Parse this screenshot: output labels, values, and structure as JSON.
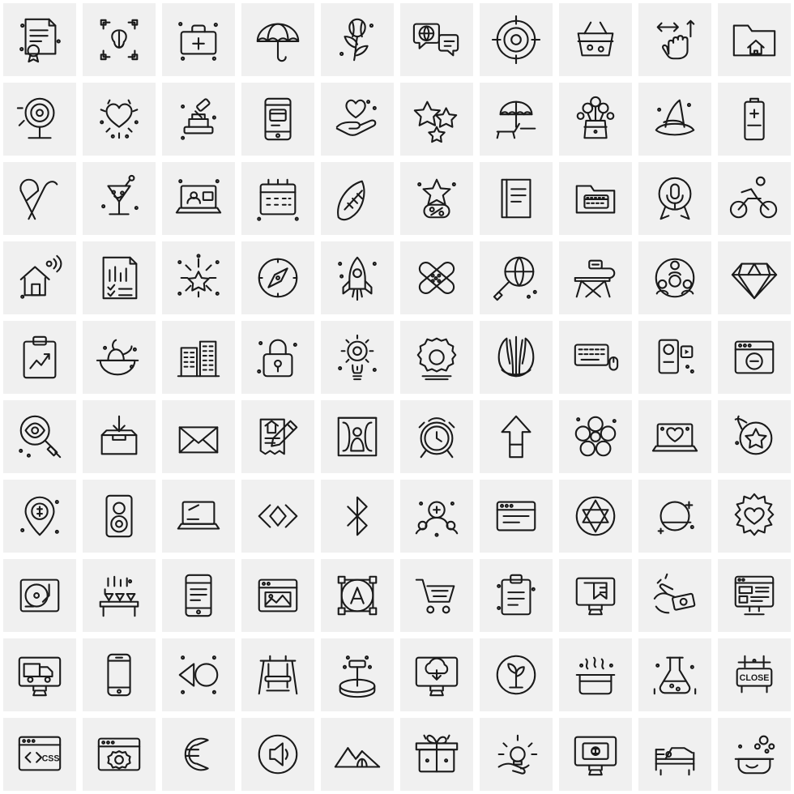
{
  "page": {
    "title": "100 Line Icon Set",
    "layout": {
      "columns": 10,
      "rows": 10,
      "cell_size_px": 98
    },
    "colors": {
      "page_background": "#ffffff",
      "cell_background": "#f0f0f0",
      "icon_stroke": "#1a1a1a"
    }
  },
  "icons": [
    {
      "row": 1,
      "col": 1,
      "name": "certificate-icon",
      "label": "Certificate"
    },
    {
      "row": 1,
      "col": 2,
      "name": "brain-select-icon",
      "label": "Brain Selection"
    },
    {
      "row": 1,
      "col": 3,
      "name": "first-aid-kit-icon",
      "label": "First Aid Kit"
    },
    {
      "row": 1,
      "col": 4,
      "name": "umbrella-icon",
      "label": "Umbrella"
    },
    {
      "row": 1,
      "col": 5,
      "name": "tulip-flower-icon",
      "label": "Tulip"
    },
    {
      "row": 1,
      "col": 6,
      "name": "global-chat-icon",
      "label": "Global Chat"
    },
    {
      "row": 1,
      "col": 7,
      "name": "target-crosshair-icon",
      "label": "Target"
    },
    {
      "row": 1,
      "col": 8,
      "name": "shopping-basket-icon",
      "label": "Shopping Basket"
    },
    {
      "row": 1,
      "col": 9,
      "name": "drag-move-hand-icon",
      "label": "Drag Move"
    },
    {
      "row": 1,
      "col": 10,
      "name": "home-folder-icon",
      "label": "Home Folder"
    },
    {
      "row": 2,
      "col": 1,
      "name": "target-stand-icon",
      "label": "Target Stand"
    },
    {
      "row": 2,
      "col": 2,
      "name": "sparkle-hearts-icon",
      "label": "Sparkling Hearts"
    },
    {
      "row": 2,
      "col": 3,
      "name": "auction-gavel-icon",
      "label": "Auction Gavel"
    },
    {
      "row": 2,
      "col": 4,
      "name": "mobile-payment-icon",
      "label": "Mobile Payment"
    },
    {
      "row": 2,
      "col": 5,
      "name": "hand-heart-icon",
      "label": "Hand with Hearts"
    },
    {
      "row": 2,
      "col": 6,
      "name": "three-stars-icon",
      "label": "Three Stars"
    },
    {
      "row": 2,
      "col": 7,
      "name": "beach-lounger-icon",
      "label": "Beach Lounger"
    },
    {
      "row": 2,
      "col": 8,
      "name": "flower-bouquet-icon",
      "label": "Flower Bouquet"
    },
    {
      "row": 2,
      "col": 9,
      "name": "witch-hat-icon",
      "label": "Witch Hat"
    },
    {
      "row": 2,
      "col": 10,
      "name": "battery-icon",
      "label": "Battery"
    },
    {
      "row": 3,
      "col": 1,
      "name": "awareness-ribbon-icon",
      "label": "Awareness Ribbon"
    },
    {
      "row": 3,
      "col": 2,
      "name": "cocktail-glass-icon",
      "label": "Cocktail"
    },
    {
      "row": 3,
      "col": 3,
      "name": "video-call-laptop-icon",
      "label": "Video Call"
    },
    {
      "row": 3,
      "col": 4,
      "name": "calendar-icon",
      "label": "Calendar"
    },
    {
      "row": 3,
      "col": 5,
      "name": "american-football-icon",
      "label": "American Football"
    },
    {
      "row": 3,
      "col": 6,
      "name": "star-discount-tag-icon",
      "label": "Star Discount"
    },
    {
      "row": 3,
      "col": 7,
      "name": "document-file-icon",
      "label": "Document"
    },
    {
      "row": 3,
      "col": 8,
      "name": "taxi-screen-icon",
      "label": "Taxi Display"
    },
    {
      "row": 3,
      "col": 9,
      "name": "microphone-badge-icon",
      "label": "Microphone Badge"
    },
    {
      "row": 3,
      "col": 10,
      "name": "cyclist-icon",
      "label": "Cyclist"
    },
    {
      "row": 4,
      "col": 1,
      "name": "smart-home-signal-icon",
      "label": "Smart Home Signal"
    },
    {
      "row": 4,
      "col": 2,
      "name": "report-checklist-icon",
      "label": "Report Checklist"
    },
    {
      "row": 4,
      "col": 3,
      "name": "firework-burst-icon",
      "label": "Firework"
    },
    {
      "row": 4,
      "col": 4,
      "name": "compass-icon",
      "label": "Compass"
    },
    {
      "row": 4,
      "col": 5,
      "name": "rocket-launch-icon",
      "label": "Rocket Launch"
    },
    {
      "row": 4,
      "col": 6,
      "name": "bandage-cross-icon",
      "label": "Bandages"
    },
    {
      "row": 4,
      "col": 7,
      "name": "global-search-icon",
      "label": "Global Search"
    },
    {
      "row": 4,
      "col": 8,
      "name": "ironing-board-icon",
      "label": "Ironing Board"
    },
    {
      "row": 4,
      "col": 9,
      "name": "teamwork-circle-icon",
      "label": "Teamwork"
    },
    {
      "row": 4,
      "col": 10,
      "name": "diamond-icon",
      "label": "Diamond"
    },
    {
      "row": 5,
      "col": 1,
      "name": "clipboard-chart-icon",
      "label": "Clipboard Chart"
    },
    {
      "row": 5,
      "col": 2,
      "name": "noodle-bowl-icon",
      "label": "Noodle Bowl"
    },
    {
      "row": 5,
      "col": 3,
      "name": "office-building-icon",
      "label": "Office Building"
    },
    {
      "row": 5,
      "col": 4,
      "name": "padlock-icon",
      "label": "Padlock"
    },
    {
      "row": 5,
      "col": 5,
      "name": "idea-gear-bulb-icon",
      "label": "Idea Gear"
    },
    {
      "row": 5,
      "col": 6,
      "name": "settings-gear-icon",
      "label": "Settings Gear"
    },
    {
      "row": 5,
      "col": 7,
      "name": "feather-fan-icon",
      "label": "Feather Fan"
    },
    {
      "row": 5,
      "col": 8,
      "name": "keyboard-mouse-icon",
      "label": "Keyboard and Mouse"
    },
    {
      "row": 5,
      "col": 9,
      "name": "video-camera-icon",
      "label": "Video Camera"
    },
    {
      "row": 5,
      "col": 10,
      "name": "browser-minimize-icon",
      "label": "Browser Minimize"
    },
    {
      "row": 6,
      "col": 1,
      "name": "eye-magnifier-icon",
      "label": "Eye Magnifier"
    },
    {
      "row": 6,
      "col": 2,
      "name": "box-download-icon",
      "label": "Box Download"
    },
    {
      "row": 6,
      "col": 3,
      "name": "open-envelope-icon",
      "label": "Open Envelope"
    },
    {
      "row": 6,
      "col": 4,
      "name": "property-contract-icon",
      "label": "Property Contract"
    },
    {
      "row": 6,
      "col": 5,
      "name": "stage-performer-icon",
      "label": "Stage Performer"
    },
    {
      "row": 6,
      "col": 6,
      "name": "alarm-clock-icon",
      "label": "Alarm Clock"
    },
    {
      "row": 6,
      "col": 7,
      "name": "up-arrow-icon",
      "label": "Up Arrow"
    },
    {
      "row": 6,
      "col": 8,
      "name": "blossom-flower-icon",
      "label": "Blossom Flower"
    },
    {
      "row": 6,
      "col": 9,
      "name": "laptop-love-icon",
      "label": "Laptop Love"
    },
    {
      "row": 6,
      "col": 10,
      "name": "star-medal-icon",
      "label": "Star Medal"
    },
    {
      "row": 7,
      "col": 1,
      "name": "money-location-icon",
      "label": "Money Location"
    },
    {
      "row": 7,
      "col": 2,
      "name": "speaker-icon",
      "label": "Speaker"
    },
    {
      "row": 7,
      "col": 3,
      "name": "laptop-icon",
      "label": "Laptop"
    },
    {
      "row": 7,
      "col": 4,
      "name": "code-brackets-icon",
      "label": "Code Brackets"
    },
    {
      "row": 7,
      "col": 5,
      "name": "bluetooth-icon",
      "label": "Bluetooth"
    },
    {
      "row": 7,
      "col": 6,
      "name": "add-user-group-icon",
      "label": "Add User Group"
    },
    {
      "row": 7,
      "col": 7,
      "name": "browser-window-icon",
      "label": "Browser Window"
    },
    {
      "row": 7,
      "col": 8,
      "name": "star-of-david-icon",
      "label": "Star of David"
    },
    {
      "row": 7,
      "col": 9,
      "name": "planet-sparkle-icon",
      "label": "Planet"
    },
    {
      "row": 7,
      "col": 10,
      "name": "heart-burst-icon",
      "label": "Heart Burst"
    },
    {
      "row": 8,
      "col": 1,
      "name": "vinyl-turntable-icon",
      "label": "Turntable"
    },
    {
      "row": 8,
      "col": 2,
      "name": "bar-counter-icon",
      "label": "Bar Counter"
    },
    {
      "row": 8,
      "col": 3,
      "name": "tablet-text-icon",
      "label": "Tablet Text"
    },
    {
      "row": 8,
      "col": 4,
      "name": "browser-image-icon",
      "label": "Browser Image"
    },
    {
      "row": 8,
      "col": 5,
      "name": "typography-node-icon",
      "label": "Typography Node"
    },
    {
      "row": 8,
      "col": 6,
      "name": "shopping-cart-icon",
      "label": "Shopping Cart"
    },
    {
      "row": 8,
      "col": 7,
      "name": "clipboard-list-icon",
      "label": "Clipboard List"
    },
    {
      "row": 8,
      "col": 8,
      "name": "monitor-bookmark-icon",
      "label": "Monitor Bookmark"
    },
    {
      "row": 8,
      "col": 9,
      "name": "cash-exchange-icon",
      "label": "Cash Exchange"
    },
    {
      "row": 8,
      "col": 10,
      "name": "web-layout-monitor-icon",
      "label": "Web Layout"
    },
    {
      "row": 9,
      "col": 1,
      "name": "delivery-truck-monitor-icon",
      "label": "Delivery Tracking"
    },
    {
      "row": 9,
      "col": 2,
      "name": "smartphone-icon",
      "label": "Smartphone"
    },
    {
      "row": 9,
      "col": 3,
      "name": "shape-tools-icon",
      "label": "Shape Tools"
    },
    {
      "row": 9,
      "col": 4,
      "name": "swing-bench-icon",
      "label": "Swing Bench"
    },
    {
      "row": 9,
      "col": 5,
      "name": "podium-stage-icon",
      "label": "Podium Stage"
    },
    {
      "row": 9,
      "col": 6,
      "name": "cloud-download-monitor-icon",
      "label": "Cloud Download"
    },
    {
      "row": 9,
      "col": 7,
      "name": "tree-badge-icon",
      "label": "Tree Badge"
    },
    {
      "row": 9,
      "col": 8,
      "name": "cooking-pot-icon",
      "label": "Cooking Pot"
    },
    {
      "row": 9,
      "col": 9,
      "name": "chemistry-flask-icon",
      "label": "Chemistry Flask"
    },
    {
      "row": 9,
      "col": 10,
      "name": "closed-sign-icon",
      "label": "Closed Sign",
      "text": "CLOSE"
    },
    {
      "row": 10,
      "col": 1,
      "name": "css-code-browser-icon",
      "label": "CSS Code",
      "text": "CSS"
    },
    {
      "row": 10,
      "col": 2,
      "name": "browser-settings-icon",
      "label": "Browser Settings"
    },
    {
      "row": 10,
      "col": 3,
      "name": "euro-coin-icon",
      "label": "Euro Coin"
    },
    {
      "row": 10,
      "col": 4,
      "name": "volume-speaker-icon",
      "label": "Volume"
    },
    {
      "row": 10,
      "col": 5,
      "name": "mountain-landscape-icon",
      "label": "Mountain Landscape"
    },
    {
      "row": 10,
      "col": 6,
      "name": "gift-box-icon",
      "label": "Gift Box"
    },
    {
      "row": 10,
      "col": 7,
      "name": "hand-idea-icon",
      "label": "Hand Idea"
    },
    {
      "row": 10,
      "col": 8,
      "name": "money-monitor-icon",
      "label": "Money Monitor"
    },
    {
      "row": 10,
      "col": 9,
      "name": "hospital-bed-icon",
      "label": "Hospital Bed"
    },
    {
      "row": 10,
      "col": 10,
      "name": "washing-bowl-icon",
      "label": "Washing Bowl"
    }
  ]
}
